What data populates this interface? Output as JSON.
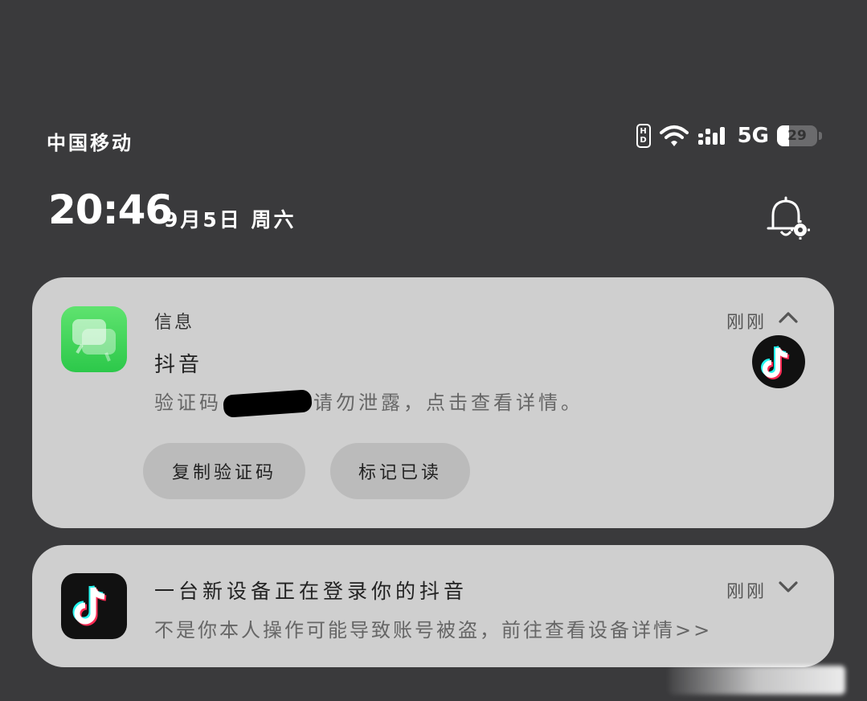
{
  "status_bar": {
    "carrier": "中国移动",
    "hd_label_top": "H",
    "hd_label_bottom": "D",
    "network_type": "5G",
    "battery_level": "29",
    "icons": [
      "hd-icon",
      "wifi-icon",
      "signal-icon",
      "battery-icon"
    ]
  },
  "lock": {
    "time": "20:46",
    "date": "9月5日 周六",
    "bell_icon": "notification-settings-icon"
  },
  "notifications": [
    {
      "app": "信息",
      "time": "刚刚",
      "sender": "抖音",
      "body_prefix": "验证码",
      "body_suffix": "请勿泄露，点击查看详情。",
      "actions": [
        "复制验证码",
        "标记已读"
      ],
      "icon": "messages-icon",
      "avatar": "tiktok-avatar-icon",
      "expanded": true
    },
    {
      "title": "一台新设备正在登录你的抖音",
      "time": "刚刚",
      "body": "不是你本人操作可能导致账号被盗，前往查看设备详情>>",
      "icon": "tiktok-icon",
      "expanded": false
    }
  ],
  "colors": {
    "background": "#3a3a3c",
    "card": "#cfcfcf",
    "button": "#bbbbbb",
    "messages_green": "#2cc84a",
    "tiktok_cyan": "#25f4ee",
    "tiktok_red": "#fe2c55"
  }
}
